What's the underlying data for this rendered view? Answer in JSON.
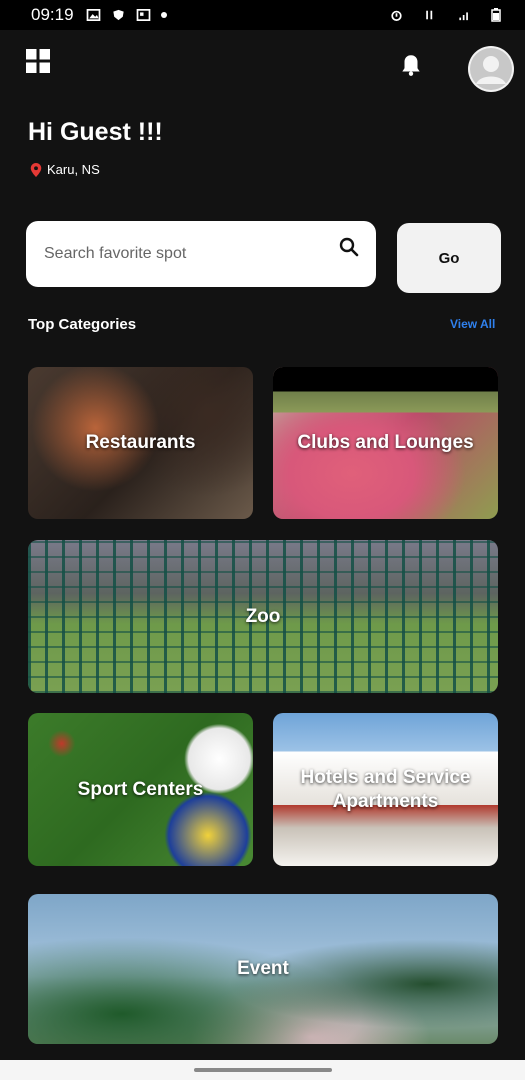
{
  "status_bar": {
    "time": "09:19"
  },
  "header": {
    "greeting": "Hi Guest !!!",
    "location": "Karu, NS"
  },
  "search": {
    "placeholder": "Search favorite spot",
    "go_label": "Go"
  },
  "categories": {
    "title": "Top Categories",
    "view_all": "View All",
    "items": [
      {
        "label": "Restaurants"
      },
      {
        "label": "Clubs and Lounges"
      },
      {
        "label": "Zoo"
      },
      {
        "label": "Sport Centers"
      },
      {
        "label": "Hotels and Service Apartments"
      },
      {
        "label": "Event"
      }
    ]
  },
  "colors": {
    "background": "#121212",
    "accent": "#2f80ed",
    "pin": "#e53935"
  }
}
